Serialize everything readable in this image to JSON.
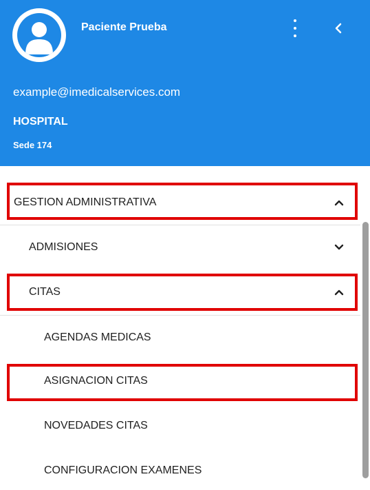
{
  "profile": {
    "name": "Paciente Prueba",
    "email": "example@imedicalservices.com",
    "institution": "HOSPITAL",
    "site": "Sede 174"
  },
  "menu": {
    "section": {
      "label": "GESTION ADMINISTRATIVA",
      "state": "expanded"
    },
    "groups": [
      {
        "label": "ADMISIONES",
        "state": "collapsed"
      },
      {
        "label": "CITAS",
        "state": "expanded"
      }
    ],
    "citas_items": [
      {
        "label": "AGENDAS MEDICAS"
      },
      {
        "label": "ASIGNACION CITAS",
        "highlighted": true
      },
      {
        "label": "NOVEDADES CITAS"
      },
      {
        "label": "CONFIGURACION EXAMENES"
      }
    ]
  },
  "colors": {
    "header_bg": "#1e88e5",
    "highlight_border": "#e00000",
    "text": "#212121"
  },
  "icons": {
    "avatar": "person-avatar-icon",
    "more": "kebab-menu-icon",
    "collapse": "chevron-left-icon",
    "expanded": "chevron-up-icon",
    "collapsed": "chevron-down-icon"
  }
}
